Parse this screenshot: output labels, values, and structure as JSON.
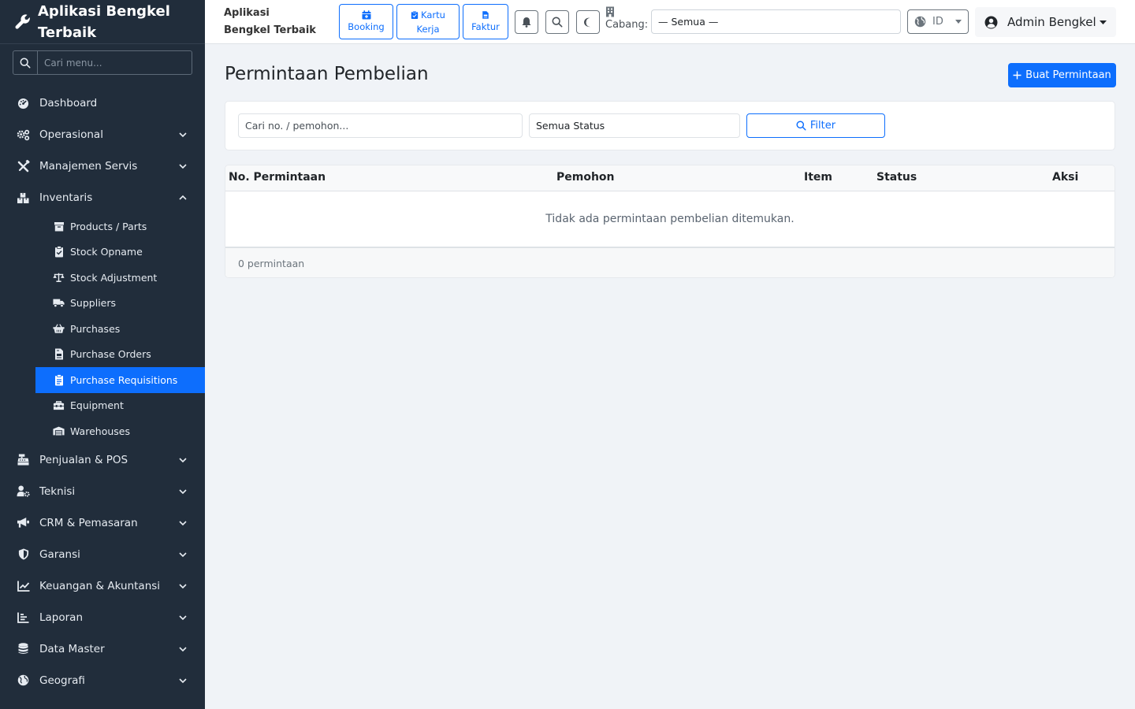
{
  "app": {
    "name": "Aplikasi Bengkel Terbaik"
  },
  "sidebar": {
    "search_placeholder": "Cari menu...",
    "items": [
      {
        "label": "Dashboard",
        "icon": "dashboard-icon",
        "expandable": false
      },
      {
        "label": "Operasional",
        "icon": "cogs-icon",
        "expandable": true
      },
      {
        "label": "Manajemen Servis",
        "icon": "tools-icon",
        "expandable": true
      },
      {
        "label": "Inventaris",
        "icon": "boxes-icon",
        "expandable": true,
        "expanded": true
      }
    ],
    "inventaris_sub": [
      {
        "label": "Products / Parts",
        "icon": "box-icon"
      },
      {
        "label": "Stock Opname",
        "icon": "clipboard-check-icon"
      },
      {
        "label": "Stock Adjustment",
        "icon": "balance-scale-icon"
      },
      {
        "label": "Suppliers",
        "icon": "truck-icon"
      },
      {
        "label": "Purchases",
        "icon": "basket-icon"
      },
      {
        "label": "Purchase Orders",
        "icon": "file-invoice-icon"
      },
      {
        "label": "Purchase Requisitions",
        "icon": "clipboard-list-icon",
        "active": true
      },
      {
        "label": "Equipment",
        "icon": "toolbox-icon"
      },
      {
        "label": "Warehouses",
        "icon": "warehouse-icon"
      }
    ],
    "items_after": [
      {
        "label": "Penjualan & POS",
        "icon": "cash-register-icon"
      },
      {
        "label": "Teknisi",
        "icon": "user-cog-icon"
      },
      {
        "label": "CRM & Pemasaran",
        "icon": "bullhorn-icon"
      },
      {
        "label": "Garansi",
        "icon": "shield-icon"
      },
      {
        "label": "Keuangan & Akuntansi",
        "icon": "chart-line-icon"
      },
      {
        "label": "Laporan",
        "icon": "chart-bar-icon"
      },
      {
        "label": "Data Master",
        "icon": "database-icon"
      },
      {
        "label": "Geografi",
        "icon": "globe-icon"
      }
    ]
  },
  "topbar": {
    "quick": [
      {
        "line1": "Booking",
        "line2": "",
        "icon": "calendar-plus-icon"
      },
      {
        "line1": "Kartu",
        "line2": "Kerja",
        "icon": "clipboard-check-icon"
      },
      {
        "line1": "Faktur",
        "line2": "",
        "icon": "file-invoice-icon"
      }
    ],
    "branch_label": "Cabang:",
    "branch_value": "— Semua —",
    "lang": "ID",
    "user": "Admin Bengkel"
  },
  "page": {
    "title": "Permintaan Pembelian",
    "create_label": "Buat Permintaan",
    "search_placeholder": "Cari no. / pemohon...",
    "status_value": "Semua Status",
    "filter_label": "Filter",
    "columns": [
      "No. Permintaan",
      "Pemohon",
      "Item",
      "Status",
      "Aksi"
    ],
    "empty_message": "Tidak ada permintaan pembelian ditemukan.",
    "count_label": "0 permintaan"
  },
  "colors": {
    "primary": "#0d6efd",
    "sidebar_bg": "#212d3b"
  }
}
